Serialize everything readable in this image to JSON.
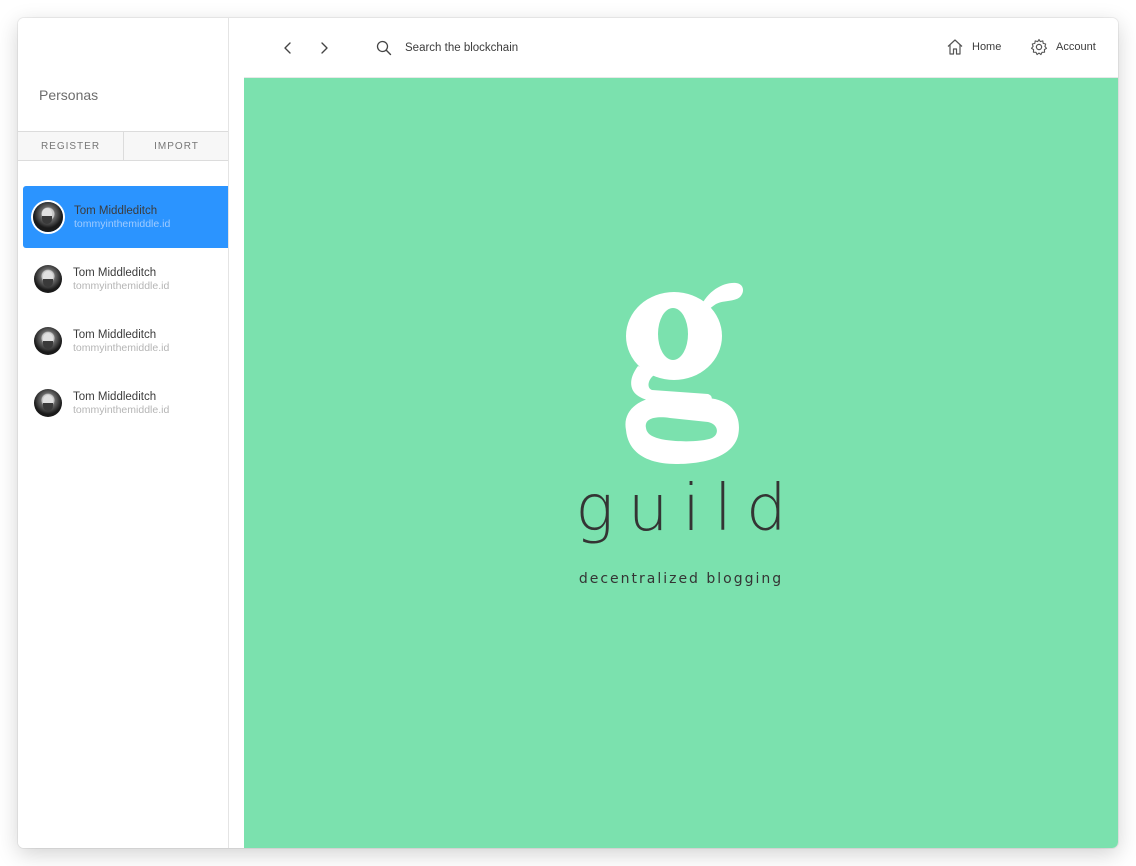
{
  "sidebar": {
    "title": "Personas",
    "tabs": [
      {
        "label": "REGISTER"
      },
      {
        "label": "IMPORT"
      }
    ],
    "personas": [
      {
        "name": "Tom Middleditch",
        "id": "tommyinthemiddle.id",
        "active": true
      },
      {
        "name": "Tom Middleditch",
        "id": "tommyinthemiddle.id",
        "active": false
      },
      {
        "name": "Tom Middleditch",
        "id": "tommyinthemiddle.id",
        "active": false
      },
      {
        "name": "Tom Middleditch",
        "id": "tommyinthemiddle.id",
        "active": false
      }
    ]
  },
  "topbar": {
    "search_placeholder": "Search the blockchain",
    "home_label": "Home",
    "account_label": "Account"
  },
  "content": {
    "wordmark": "guild",
    "tagline": "decentralized blogging",
    "background_color": "#7be1ae"
  },
  "colors": {
    "active_persona": "#2b94ff"
  }
}
